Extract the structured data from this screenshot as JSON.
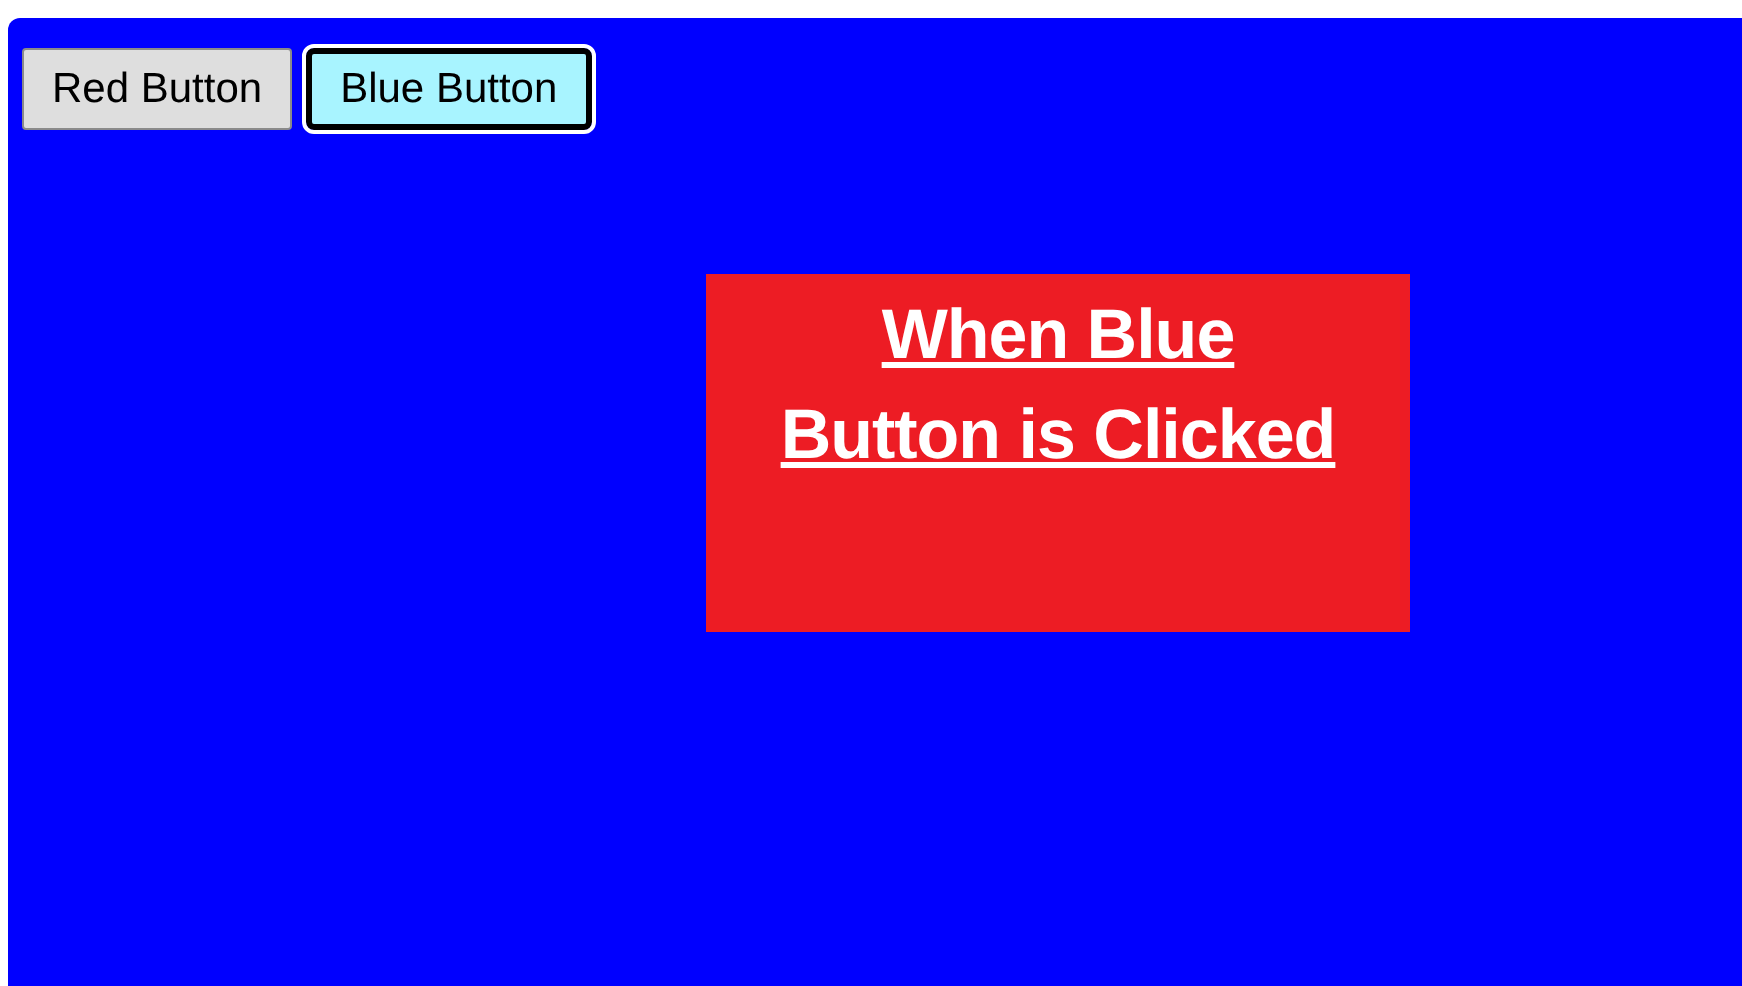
{
  "buttons": [
    {
      "label": "Red Button",
      "selected": false
    },
    {
      "label": "Blue Button",
      "selected": true
    }
  ],
  "panel": {
    "heading": "When Blue\nButton is Clicked"
  }
}
